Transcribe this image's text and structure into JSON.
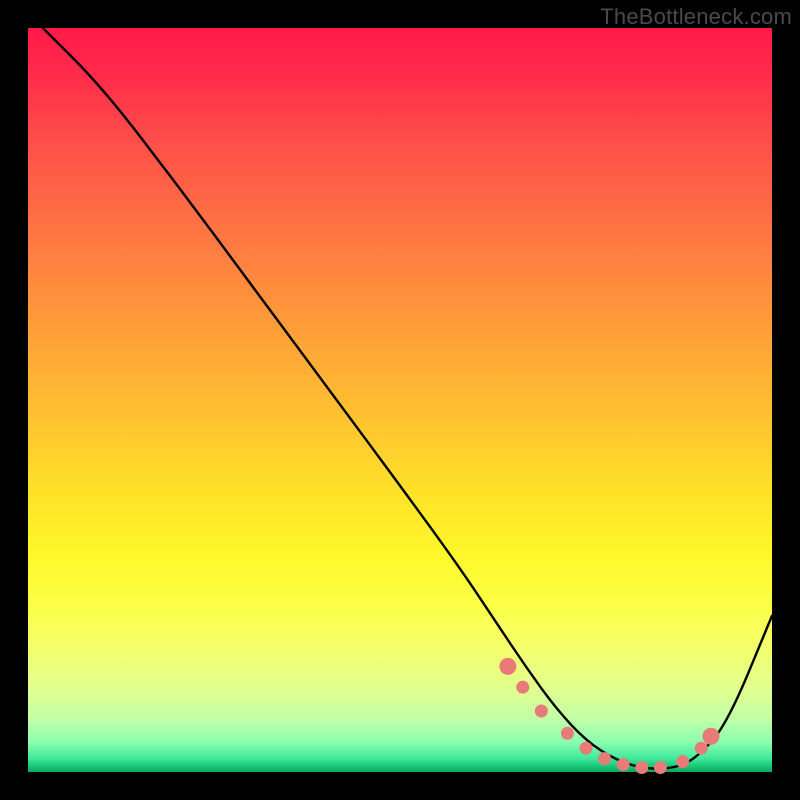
{
  "watermark": "TheBottleneck.com",
  "chart_data": {
    "type": "line",
    "title": "",
    "xlabel": "",
    "ylabel": "",
    "xlim": [
      0,
      100
    ],
    "ylim": [
      0,
      100
    ],
    "series": [
      {
        "name": "curve",
        "x": [
          2,
          10,
          20,
          30,
          40,
          50,
          58,
          63,
          67,
          71,
          75,
          79,
          83,
          87,
          90,
          94,
          100
        ],
        "y": [
          100,
          92,
          79,
          65.5,
          52,
          38.5,
          27.5,
          20,
          14,
          8.5,
          4.2,
          1.6,
          0.4,
          0.5,
          2.0,
          6.5,
          21
        ]
      }
    ],
    "markers": {
      "name": "selected-range-dots",
      "color": "#e87a78",
      "x": [
        64.5,
        66.5,
        69,
        72.5,
        75,
        77.5,
        80,
        82.5,
        85,
        88,
        90.5,
        91.8
      ],
      "y": [
        14.2,
        11.4,
        8.2,
        5.2,
        3.2,
        1.8,
        1.0,
        0.6,
        0.6,
        1.4,
        3.2,
        4.8
      ]
    },
    "gradient_stops": [
      {
        "pos": 0.0,
        "color": "#ff1a4a"
      },
      {
        "pos": 0.14,
        "color": "#ff4a4a"
      },
      {
        "pos": 0.34,
        "color": "#ff8a3e"
      },
      {
        "pos": 0.54,
        "color": "#ffc72e"
      },
      {
        "pos": 0.71,
        "color": "#fff82a"
      },
      {
        "pos": 0.89,
        "color": "#e0ff90"
      },
      {
        "pos": 0.98,
        "color": "#40e89a"
      },
      {
        "pos": 1.0,
        "color": "#0aa860"
      }
    ]
  }
}
